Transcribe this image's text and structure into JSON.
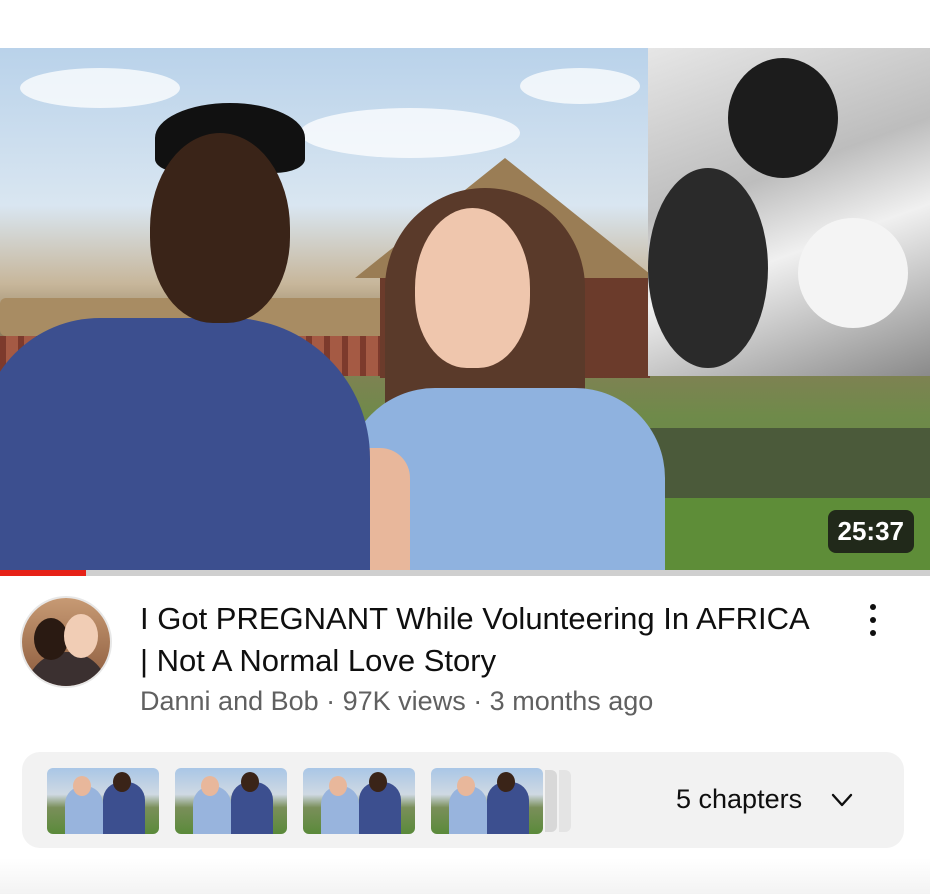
{
  "video": {
    "duration": "25:37",
    "progress_fraction": 0.092,
    "title": "I Got PREGNANT While Volunteering In AFRICA | Not A Normal Love Story",
    "meta": "Danni and Bob · 97K views · 3 months ago"
  },
  "chapters": {
    "label": "5 chapters",
    "count_thumbnails": 4
  },
  "icons": {
    "more": "kebab-menu-icon",
    "expand": "chevron-down-icon"
  },
  "colors": {
    "progress": "#e62117",
    "chip_bg": "#f2f2f2",
    "meta_text": "#606060"
  }
}
